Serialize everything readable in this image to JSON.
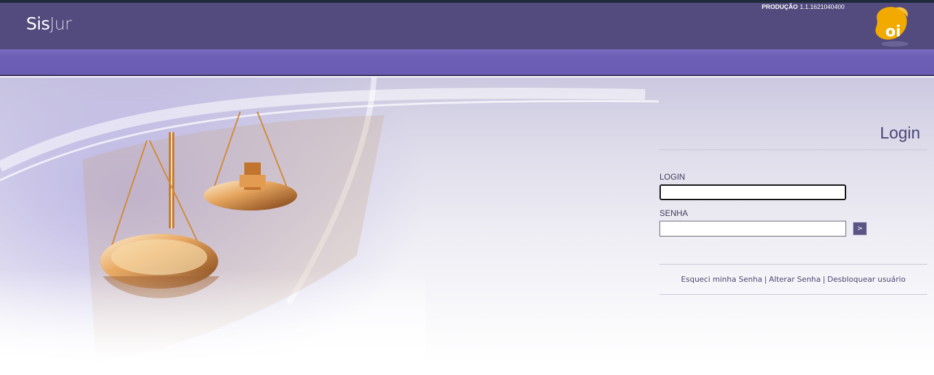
{
  "header": {
    "brand_first": "Sis",
    "brand_second": "Jur",
    "environment_label": "PRODUÇÃO",
    "version": "1.1.1621040400",
    "logo_text": "oi"
  },
  "login": {
    "title": "Login",
    "login_label": "LOGIN",
    "login_value": "",
    "password_label": "SENHA",
    "password_value": "",
    "submit_label": ">"
  },
  "links": {
    "forgot_password": "Esqueci minha Senha",
    "separator": "|",
    "change_password": "Alterar Senha",
    "unlock_user": "Desbloquear usuário"
  },
  "colors": {
    "header": "#534b7d",
    "subbar": "#6e5fb6",
    "logo": "#f2a900",
    "text": "#4b4578"
  },
  "icons": {
    "hero_image": "scales-of-justice-icon",
    "logo": "oi-logo-icon"
  }
}
